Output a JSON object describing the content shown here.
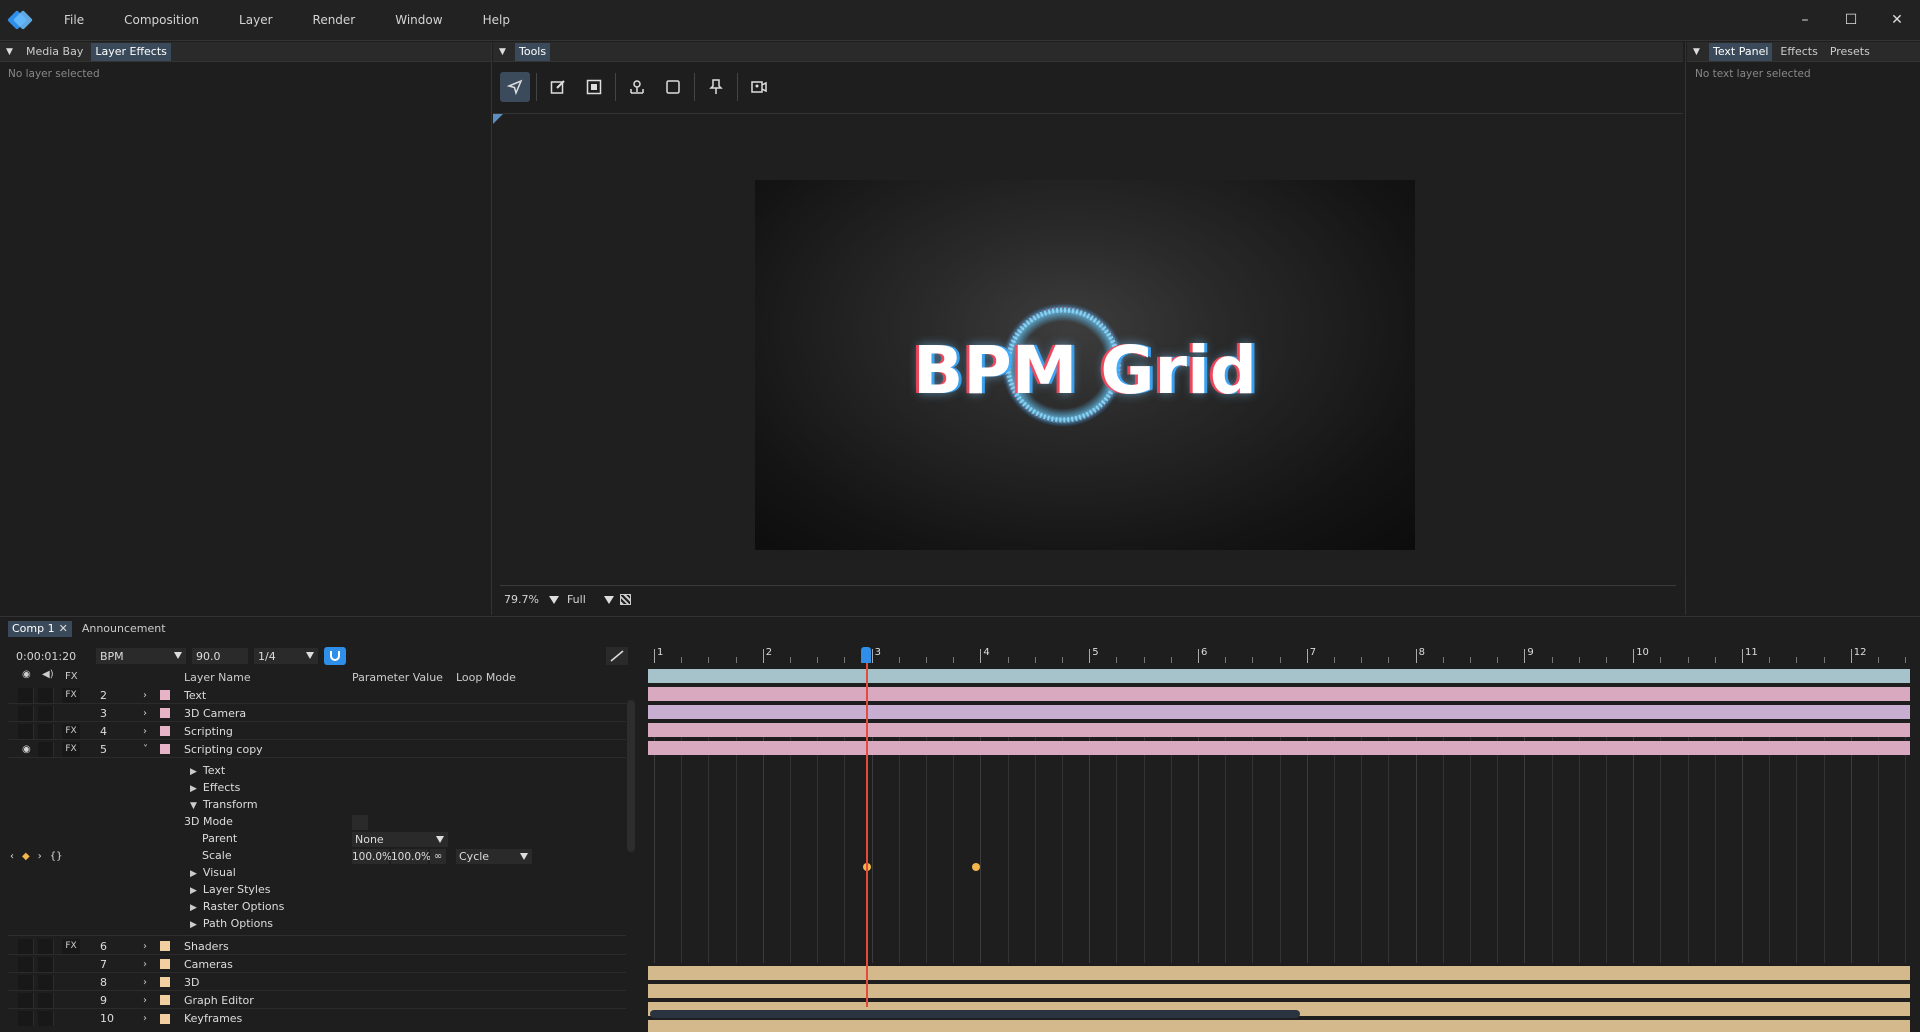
{
  "app": {
    "menu": [
      "File",
      "Composition",
      "Layer",
      "Render",
      "Window",
      "Help"
    ],
    "window_controls": [
      "–",
      "☐",
      "✕"
    ]
  },
  "left_panel": {
    "tabs": [
      "Media Bay",
      "Layer Effects"
    ],
    "active_tab": "Layer Effects",
    "placeholder": "No layer selected"
  },
  "center_panel": {
    "tab": "Tools",
    "tools": [
      "select-icon",
      "edit-icon",
      "mask-icon",
      "anchor-icon",
      "rect-icon",
      "pin-icon",
      "camera-icon"
    ],
    "preview_title": "BPM Grid",
    "zoom": "79.7%",
    "quality": "Full"
  },
  "right_panel": {
    "tabs": [
      "Text Panel",
      "Effects",
      "Presets"
    ],
    "active_tab": "Text Panel",
    "placeholder": "No text layer selected"
  },
  "timeline": {
    "comp_tabs": [
      "Comp 1",
      "Announcement"
    ],
    "timecode": "0:00:01:20",
    "mode": "BPM",
    "bpm": "90.0",
    "division": "1/4",
    "columns": {
      "fx": "FX",
      "layer_name": "Layer Name",
      "parameter_value": "Parameter Value",
      "loop_mode": "Loop Mode"
    },
    "layers_top": [
      {
        "num": "2",
        "name": "Text",
        "fx": "FX",
        "color": "#e7b3c7"
      },
      {
        "num": "3",
        "name": "3D Camera",
        "fx": "",
        "color": "#e7b3c7"
      },
      {
        "num": "4",
        "name": "Scripting",
        "fx": "FX",
        "color": "#e7b3c7"
      },
      {
        "num": "5",
        "name": "Scripting copy",
        "fx": "FX",
        "color": "#e7b3c7"
      }
    ],
    "properties": {
      "text": "Text",
      "effects": "Effects",
      "transform": "Transform",
      "mode_3d": "3D Mode",
      "parent_label": "Parent",
      "parent_value": "None",
      "scale_label": "Scale",
      "scale_x": "100.0%",
      "scale_y": "100.0%",
      "loop_value": "Cycle",
      "visual": "Visual",
      "layer_styles": "Layer Styles",
      "raster_options": "Raster Options",
      "path_options": "Path Options"
    },
    "layers_bottom": [
      {
        "num": "6",
        "name": "Shaders",
        "fx": "FX",
        "color": "#f1cfa0"
      },
      {
        "num": "7",
        "name": "Cameras",
        "fx": "",
        "color": "#f1cfa0"
      },
      {
        "num": "8",
        "name": "3D",
        "fx": "",
        "color": "#f1cfa0"
      },
      {
        "num": "9",
        "name": "Graph Editor",
        "fx": "",
        "color": "#f1cfa0"
      },
      {
        "num": "10",
        "name": "Keyframes",
        "fx": "",
        "color": "#f1cfa0"
      }
    ],
    "ruler_labels": [
      "1",
      "2",
      "3",
      "4",
      "5",
      "6",
      "7",
      "8",
      "9",
      "10",
      "11",
      "12"
    ]
  }
}
